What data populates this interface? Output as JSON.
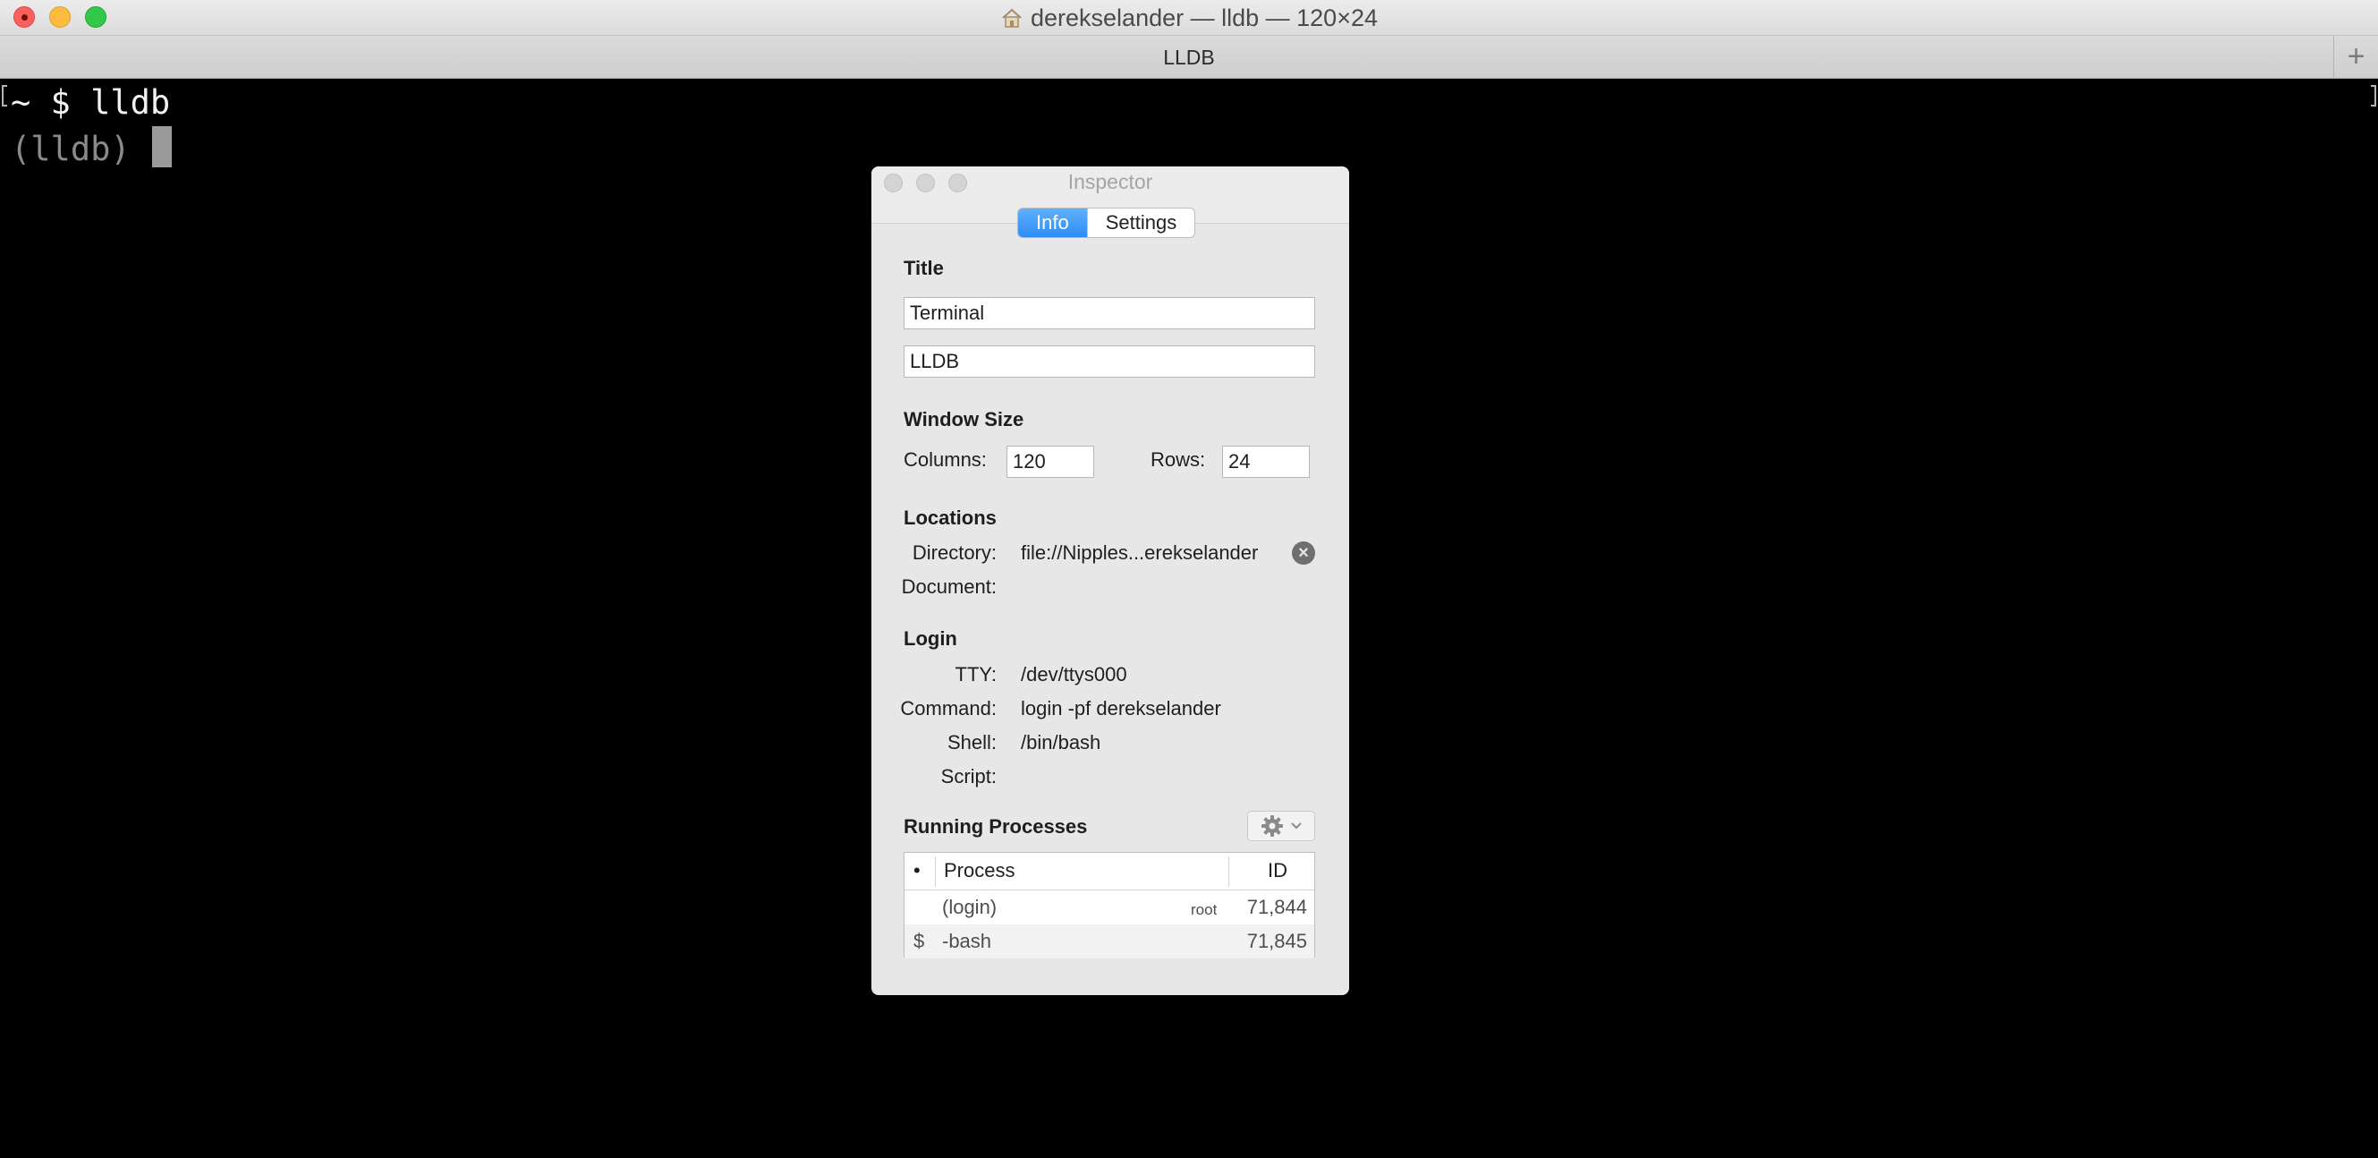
{
  "window": {
    "title": "derekselander — lldb — 120×24"
  },
  "tabbar": {
    "tab_label": "LLDB",
    "new_tab": "+"
  },
  "terminal": {
    "line1": "~ $ lldb",
    "line2": "(lldb) "
  },
  "inspector": {
    "title": "Inspector",
    "tabs": [
      {
        "label": "Info",
        "active": true
      },
      {
        "label": "Settings",
        "active": false
      }
    ],
    "title_section": {
      "heading": "Title",
      "field1": "Terminal",
      "field2": "LLDB"
    },
    "window_size": {
      "heading": "Window Size",
      "columns_label": "Columns:",
      "columns_value": "120",
      "rows_label": "Rows:",
      "rows_value": "24"
    },
    "locations": {
      "heading": "Locations",
      "directory_label": "Directory:",
      "directory_value": "file://Nipples...erekselander",
      "document_label": "Document:"
    },
    "login": {
      "heading": "Login",
      "tty_label": "TTY:",
      "tty_value": "/dev/ttys000",
      "command_label": "Command:",
      "command_value": "login -pf derekselander",
      "shell_label": "Shell:",
      "shell_value": "/bin/bash",
      "script_label": "Script:"
    },
    "processes": {
      "heading": "Running Processes",
      "columns": {
        "marker": "•",
        "process": "Process",
        "id": "ID"
      },
      "rows": [
        {
          "marker": "",
          "name": "(login)",
          "user": "root",
          "id": "71,844"
        },
        {
          "marker": "$",
          "name": "-bash",
          "user": "",
          "id": "71,845"
        }
      ]
    }
  },
  "colors": {
    "accent": "#2f8cf5",
    "terminal_bg": "#000000",
    "panel_bg": "#e7e7e7"
  }
}
